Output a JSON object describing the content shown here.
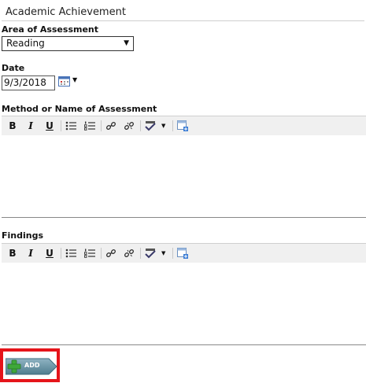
{
  "section": {
    "title": "Academic Achievement"
  },
  "area": {
    "label": "Area of Assessment",
    "selected": "Reading"
  },
  "date": {
    "label": "Date",
    "value": "9/3/2018"
  },
  "method": {
    "label": "Method or Name of Assessment",
    "value": ""
  },
  "findings": {
    "label": "Findings",
    "value": ""
  },
  "toolbar": {
    "bold": "B",
    "italic": "I",
    "underline": "U"
  },
  "add_button": {
    "label": "ADD"
  },
  "colors": {
    "highlight_border": "#e5141a",
    "toolbar_bg": "#f0f0f0",
    "add_button": "#5f8a9a"
  }
}
